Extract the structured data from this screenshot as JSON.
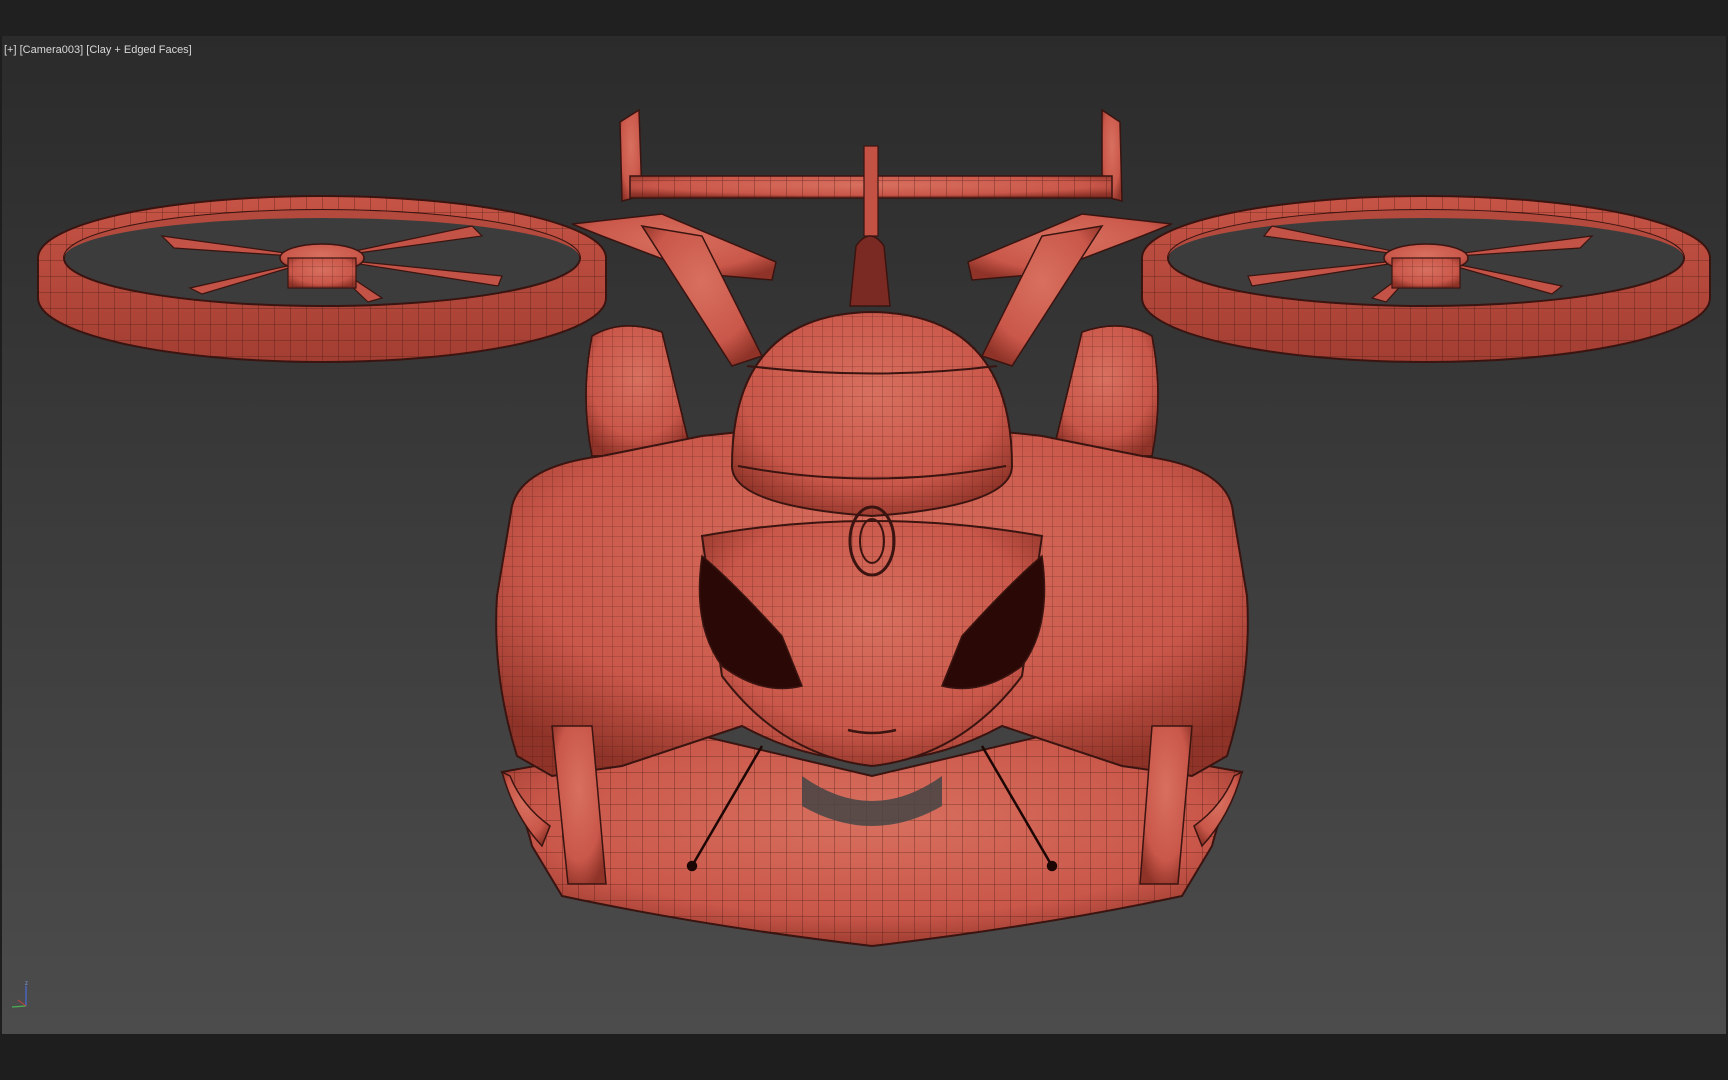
{
  "viewport": {
    "menu_label": "[+]",
    "camera_label": "[Camera003]",
    "shading_label": "[Clay + Edged Faces]"
  },
  "gizmo": {
    "z_label": "z"
  },
  "colors": {
    "clay": "#c9574a",
    "clay_dark": "#8f3328",
    "clay_light": "#d8705f",
    "wire": "#3a1410",
    "cavity": "#2a0806"
  },
  "icons": {
    "axis_gizmo": "axis-tripod-icon"
  }
}
